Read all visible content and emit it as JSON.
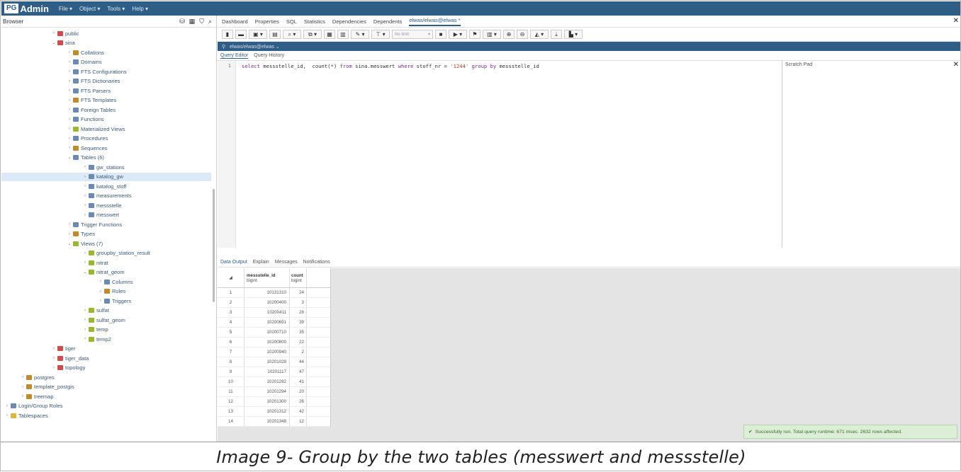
{
  "app": {
    "logo_prefix": "PG",
    "logo_text": "Admin",
    "menu": [
      "File ▾",
      "Object ▾",
      "Tools ▾",
      "Help ▾"
    ]
  },
  "browser": {
    "title": "Browser",
    "tree": [
      {
        "label": "public",
        "icon": "schema-icon",
        "color": "#d04b4b",
        "depth": 6,
        "twisty": "›"
      },
      {
        "label": "sina",
        "icon": "schema-icon",
        "color": "#d04b4b",
        "depth": 6,
        "twisty": "⌄"
      },
      {
        "label": "Collations",
        "icon": "collation-icon",
        "color": "#c08b2c",
        "depth": 8,
        "twisty": "›"
      },
      {
        "label": "Domains",
        "icon": "domain-icon",
        "color": "#6a8ab5",
        "depth": 8,
        "twisty": "›"
      },
      {
        "label": "FTS Configurations",
        "icon": "fts-config-icon",
        "color": "#6a8ab5",
        "depth": 8,
        "twisty": "›"
      },
      {
        "label": "FTS Dictionaries",
        "icon": "fts-dict-icon",
        "color": "#6a8ab5",
        "depth": 8,
        "twisty": "›"
      },
      {
        "label": "FTS Parsers",
        "icon": "fts-parser-icon",
        "color": "#6a8ab5",
        "depth": 8,
        "twisty": "›"
      },
      {
        "label": "FTS Templates",
        "icon": "fts-template-icon",
        "color": "#c08b2c",
        "depth": 8,
        "twisty": "›"
      },
      {
        "label": "Foreign Tables",
        "icon": "foreign-table-icon",
        "color": "#6a8ab5",
        "depth": 8,
        "twisty": "›"
      },
      {
        "label": "Functions",
        "icon": "function-icon",
        "color": "#6a8ab5",
        "depth": 8,
        "twisty": "›"
      },
      {
        "label": "Materialized Views",
        "icon": "matview-icon",
        "color": "#9ab82e",
        "depth": 8,
        "twisty": "›"
      },
      {
        "label": "Procedures",
        "icon": "procedure-icon",
        "color": "#6a8ab5",
        "depth": 8,
        "twisty": "›"
      },
      {
        "label": "Sequences",
        "icon": "sequence-icon",
        "color": "#c08b2c",
        "depth": 8,
        "twisty": "›"
      },
      {
        "label": "Tables (6)",
        "icon": "tables-icon",
        "color": "#6a8ab5",
        "depth": 8,
        "twisty": "⌄"
      },
      {
        "label": "gw_stations",
        "icon": "table-icon",
        "color": "#6a8ab5",
        "depth": 10,
        "twisty": "›"
      },
      {
        "label": "katalog_gw",
        "icon": "table-icon",
        "color": "#6a8ab5",
        "depth": 10,
        "twisty": "›",
        "selected": true
      },
      {
        "label": "katalog_stoff",
        "icon": "table-icon",
        "color": "#6a8ab5",
        "depth": 10,
        "twisty": "›"
      },
      {
        "label": "measurements",
        "icon": "table-icon",
        "color": "#6a8ab5",
        "depth": 10,
        "twisty": "›"
      },
      {
        "label": "messstelle",
        "icon": "table-icon",
        "color": "#6a8ab5",
        "depth": 10,
        "twisty": "›"
      },
      {
        "label": "messwert",
        "icon": "table-icon",
        "color": "#6a8ab5",
        "depth": 10,
        "twisty": "›"
      },
      {
        "label": "Trigger Functions",
        "icon": "trigger-function-icon",
        "color": "#6a8ab5",
        "depth": 8,
        "twisty": "›"
      },
      {
        "label": "Types",
        "icon": "type-icon",
        "color": "#c08b2c",
        "depth": 8,
        "twisty": "›"
      },
      {
        "label": "Views (7)",
        "icon": "views-icon",
        "color": "#9ab82e",
        "depth": 8,
        "twisty": "⌄"
      },
      {
        "label": "groupby_station_result",
        "icon": "view-icon",
        "color": "#9ab82e",
        "depth": 10,
        "twisty": "›"
      },
      {
        "label": "nitrat",
        "icon": "view-icon",
        "color": "#9ab82e",
        "depth": 10,
        "twisty": "›"
      },
      {
        "label": "nitrat_geom",
        "icon": "view-icon",
        "color": "#9ab82e",
        "depth": 10,
        "twisty": "⌄"
      },
      {
        "label": "Columns",
        "icon": "columns-icon",
        "color": "#6a8ab5",
        "depth": 12,
        "twisty": "›"
      },
      {
        "label": "Rules",
        "icon": "rules-icon",
        "color": "#c08b2c",
        "depth": 12,
        "twisty": "›"
      },
      {
        "label": "Triggers",
        "icon": "triggers-icon",
        "color": "#6a8ab5",
        "depth": 12,
        "twisty": "›"
      },
      {
        "label": "sulfat",
        "icon": "view-icon",
        "color": "#9ab82e",
        "depth": 10,
        "twisty": "›"
      },
      {
        "label": "sulfat_geom",
        "icon": "view-icon",
        "color": "#9ab82e",
        "depth": 10,
        "twisty": "›"
      },
      {
        "label": "temp",
        "icon": "view-icon",
        "color": "#9ab82e",
        "depth": 10,
        "twisty": "›"
      },
      {
        "label": "temp2",
        "icon": "view-icon",
        "color": "#9ab82e",
        "depth": 10,
        "twisty": "›"
      },
      {
        "label": "tiger",
        "icon": "schema-icon",
        "color": "#d04b4b",
        "depth": 6,
        "twisty": "›"
      },
      {
        "label": "tiger_data",
        "icon": "schema-icon",
        "color": "#d04b4b",
        "depth": 6,
        "twisty": "›"
      },
      {
        "label": "topology",
        "icon": "schema-icon",
        "color": "#d04b4b",
        "depth": 6,
        "twisty": "›"
      },
      {
        "label": "postgres",
        "icon": "database-icon",
        "color": "#c08b2c",
        "depth": 2,
        "twisty": "›"
      },
      {
        "label": "template_postgis",
        "icon": "database-icon",
        "color": "#c08b2c",
        "depth": 2,
        "twisty": "›"
      },
      {
        "label": "treemap",
        "icon": "database-icon",
        "color": "#c08b2c",
        "depth": 2,
        "twisty": "›"
      },
      {
        "label": "Login/Group Roles",
        "icon": "roles-icon",
        "color": "#6a8ab5",
        "depth": 0,
        "twisty": "›"
      },
      {
        "label": "Tablespaces",
        "icon": "tablespace-icon",
        "color": "#e0b43a",
        "depth": 0,
        "twisty": "›"
      }
    ]
  },
  "main": {
    "tabs": [
      "Dashboard",
      "Properties",
      "SQL",
      "Statistics",
      "Dependencies",
      "Dependents"
    ],
    "active_tab": "elwas/elwas@elwas *",
    "toolbar_limit": "No limit",
    "connection": "elwas/elwas@elwas ⌄",
    "editor_tabs": [
      "Query Editor",
      "Query History"
    ],
    "scratch_title": "Scratch Pad",
    "query": {
      "line": "1",
      "p1": "select",
      "p2": " messstelle_id,  count(*) ",
      "p3": "from",
      "p4": " sina.messwert ",
      "p5": "where",
      "p6": " stoff_nr = ",
      "p7": "'1244'",
      "p8": " ",
      "p9": "group by",
      "p10": " messstelle_id"
    },
    "output_tabs": [
      "Data Output",
      "Explain",
      "Messages",
      "Notifications"
    ],
    "result": {
      "columns": [
        {
          "name": "messstelle_id",
          "type": "bigint"
        },
        {
          "name": "count",
          "type": "bigint"
        }
      ],
      "rows": [
        [
          "1",
          "10131310",
          "24"
        ],
        [
          "2",
          "10200400",
          "3"
        ],
        [
          "3",
          "10200411",
          "28"
        ],
        [
          "4",
          "10200691",
          "39"
        ],
        [
          "5",
          "10200710",
          "35"
        ],
        [
          "6",
          "10200800",
          "22"
        ],
        [
          "7",
          "10200940",
          "2"
        ],
        [
          "8",
          "10201028",
          "44"
        ],
        [
          "9",
          "10201117",
          "47"
        ],
        [
          "10",
          "10201282",
          "41"
        ],
        [
          "11",
          "10201294",
          "20"
        ],
        [
          "12",
          "10201300",
          "26"
        ],
        [
          "13",
          "10201312",
          "42"
        ],
        [
          "14",
          "10201348",
          "12"
        ]
      ]
    },
    "toast": "Successfully run. Total query runtime: 671 msec. 2632 rows affected."
  },
  "caption": "Image 9- Group by the two tables (messwert and messstelle)"
}
